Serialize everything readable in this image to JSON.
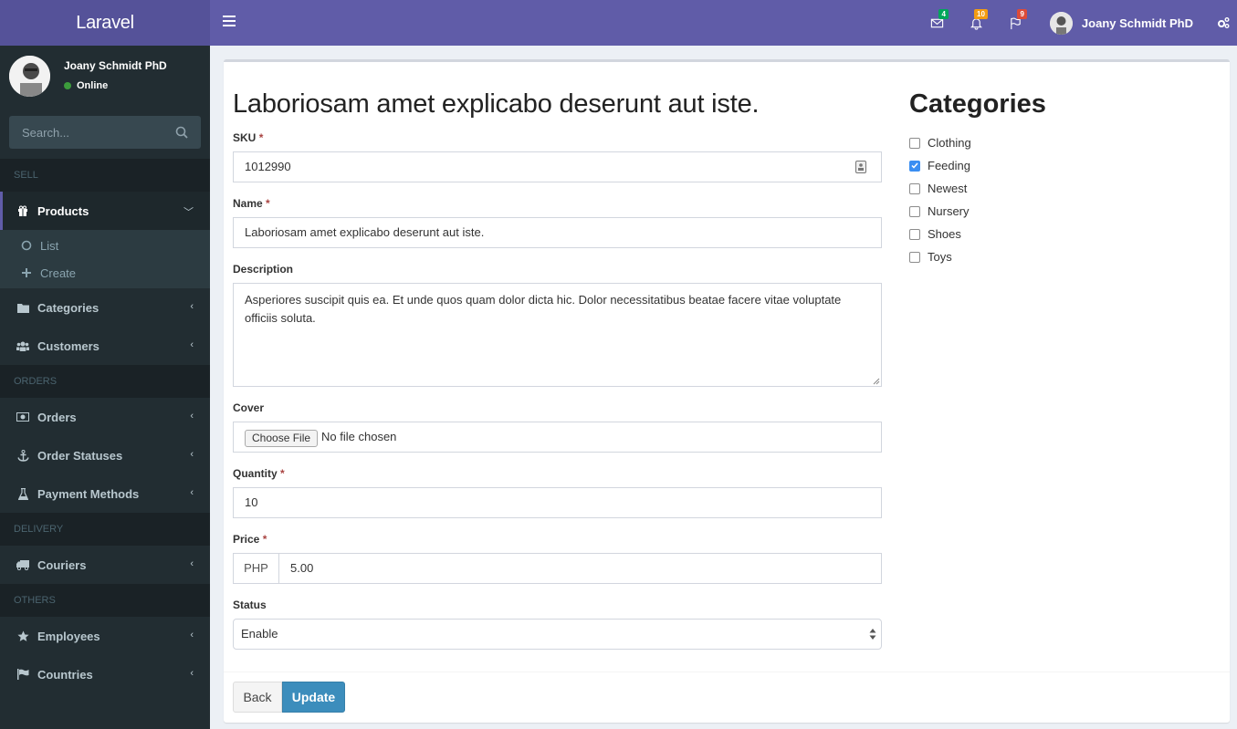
{
  "app": {
    "logo": "Laravel"
  },
  "topbar": {
    "notifications": [
      {
        "icon": "envelope-icon",
        "count": "4",
        "color": "#00a65a"
      },
      {
        "icon": "bell-icon",
        "count": "10",
        "color": "#f39c12"
      },
      {
        "icon": "flag-icon",
        "count": "9",
        "color": "#dd4b39"
      }
    ],
    "user_name": "Joany Schmidt PhD"
  },
  "sidebar": {
    "user_name": "Joany Schmidt PhD",
    "status": "Online",
    "search_placeholder": "Search...",
    "sections": [
      {
        "header": "SELL"
      },
      {
        "header": "ORDERS"
      },
      {
        "header": "DELIVERY"
      },
      {
        "header": "OTHERS"
      }
    ],
    "items": {
      "products": "Products",
      "products_list": "List",
      "products_create": "Create",
      "categories": "Categories",
      "customers": "Customers",
      "orders": "Orders",
      "order_statuses": "Order Statuses",
      "payment_methods": "Payment Methods",
      "couriers": "Couriers",
      "employees": "Employees",
      "countries": "Countries"
    }
  },
  "form": {
    "title": "Laboriosam amet explicabo deserunt aut iste.",
    "sku": {
      "label": "SKU",
      "required": "*",
      "value": "1012990"
    },
    "name": {
      "label": "Name",
      "required": "*",
      "value": "Laboriosam amet explicabo deserunt aut iste."
    },
    "description": {
      "label": "Description",
      "value": "Asperiores suscipit quis ea. Et unde quos quam dolor dicta hic. Dolor necessitatibus beatae facere vitae voluptate officiis soluta."
    },
    "cover": {
      "label": "Cover",
      "button": "Choose File",
      "status": "No file chosen"
    },
    "quantity": {
      "label": "Quantity",
      "required": "*",
      "value": "10"
    },
    "price": {
      "label": "Price",
      "required": "*",
      "currency": "PHP",
      "value": "5.00"
    },
    "status": {
      "label": "Status",
      "value": "Enable"
    },
    "back_label": "Back",
    "update_label": "Update"
  },
  "categories": {
    "title": "Categories",
    "items": [
      {
        "label": "Clothing",
        "checked": false
      },
      {
        "label": "Feeding",
        "checked": true
      },
      {
        "label": "Newest",
        "checked": false
      },
      {
        "label": "Nursery",
        "checked": false
      },
      {
        "label": "Shoes",
        "checked": false
      },
      {
        "label": "Toys",
        "checked": false
      }
    ]
  }
}
